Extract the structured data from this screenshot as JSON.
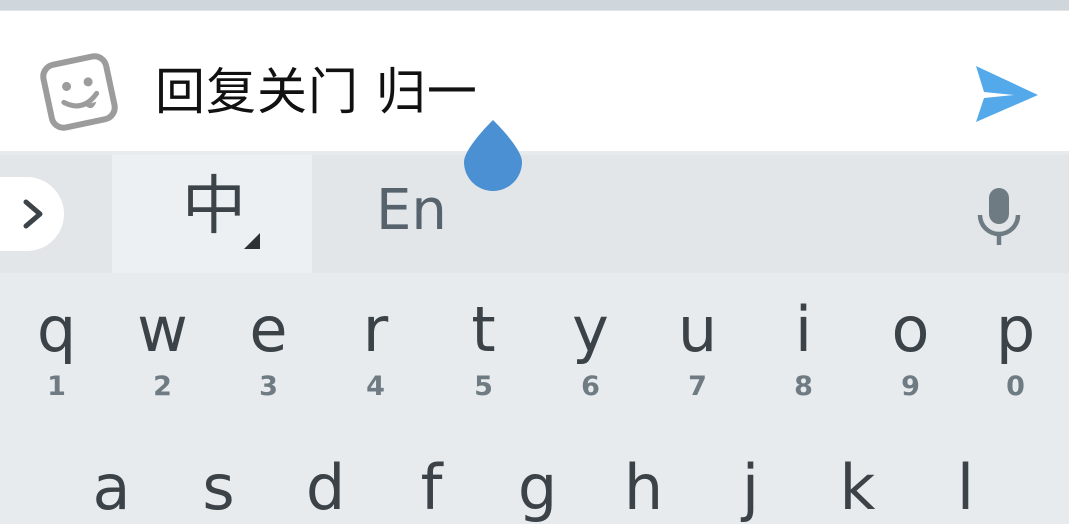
{
  "composer": {
    "message_value": "回复关门 归一",
    "accent_color": "#54a9eb",
    "cursor_color": "#4a90d2"
  },
  "icons": {
    "emoji": "sticker-face-icon",
    "send": "send-paper-plane-icon",
    "expand": "chevron-right-icon",
    "mic": "microphone-icon",
    "cursor": "text-cursor-handle-icon"
  },
  "ime": {
    "chinese_mode_label": "中",
    "english_mode_label": "En"
  },
  "keyboard": {
    "row1": [
      {
        "letter": "q",
        "hint": "1"
      },
      {
        "letter": "w",
        "hint": "2"
      },
      {
        "letter": "e",
        "hint": "3"
      },
      {
        "letter": "r",
        "hint": "4"
      },
      {
        "letter": "t",
        "hint": "5"
      },
      {
        "letter": "y",
        "hint": "6"
      },
      {
        "letter": "u",
        "hint": "7"
      },
      {
        "letter": "i",
        "hint": "8"
      },
      {
        "letter": "o",
        "hint": "9"
      },
      {
        "letter": "p",
        "hint": "0"
      }
    ],
    "row2": [
      {
        "letter": "a"
      },
      {
        "letter": "s"
      },
      {
        "letter": "d"
      },
      {
        "letter": "f"
      },
      {
        "letter": "g"
      },
      {
        "letter": "h"
      },
      {
        "letter": "j"
      },
      {
        "letter": "k"
      },
      {
        "letter": "l"
      }
    ]
  }
}
